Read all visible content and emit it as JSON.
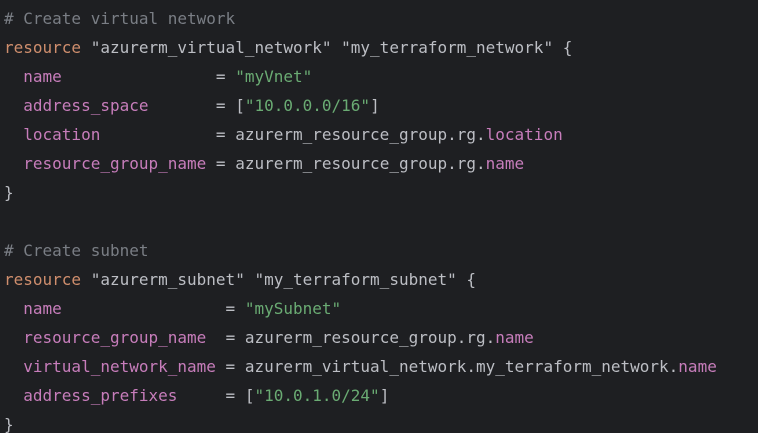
{
  "editor": {
    "theme": {
      "background": "#1e1f22",
      "comment": "#7a7e85",
      "keyword": "#cf8e6d",
      "string": "#6aab73",
      "attribute": "#c77dbb",
      "text": "#bcbec4"
    },
    "lines": [
      [
        {
          "t": "# Create virtual network",
          "c": "comment"
        }
      ],
      [
        {
          "t": "resource",
          "c": "keyword"
        },
        {
          "t": " \"azurerm_virtual_network\" \"my_terraform_network\" {",
          "c": "plain"
        }
      ],
      [
        {
          "t": "  ",
          "c": "plain"
        },
        {
          "t": "name",
          "c": "attr"
        },
        {
          "t": "                = ",
          "c": "plain"
        },
        {
          "t": "\"myVnet\"",
          "c": "string"
        }
      ],
      [
        {
          "t": "  ",
          "c": "plain"
        },
        {
          "t": "address_space",
          "c": "attr"
        },
        {
          "t": "       = [",
          "c": "plain"
        },
        {
          "t": "\"10.0.0.0/16\"",
          "c": "string"
        },
        {
          "t": "]",
          "c": "plain"
        }
      ],
      [
        {
          "t": "  ",
          "c": "plain"
        },
        {
          "t": "location",
          "c": "attr"
        },
        {
          "t": "            = azurerm_resource_group.rg.",
          "c": "plain"
        },
        {
          "t": "location",
          "c": "attr"
        }
      ],
      [
        {
          "t": "  ",
          "c": "plain"
        },
        {
          "t": "resource_group_name",
          "c": "attr"
        },
        {
          "t": " = azurerm_resource_group.rg.",
          "c": "plain"
        },
        {
          "t": "name",
          "c": "attr"
        }
      ],
      [
        {
          "t": "}",
          "c": "plain"
        }
      ],
      [],
      [
        {
          "t": "# Create subnet",
          "c": "comment"
        }
      ],
      [
        {
          "t": "resource",
          "c": "keyword"
        },
        {
          "t": " \"azurerm_subnet\" \"my_terraform_subnet\" {",
          "c": "plain"
        }
      ],
      [
        {
          "t": "  ",
          "c": "plain"
        },
        {
          "t": "name",
          "c": "attr"
        },
        {
          "t": "                 = ",
          "c": "plain"
        },
        {
          "t": "\"mySubnet\"",
          "c": "string"
        }
      ],
      [
        {
          "t": "  ",
          "c": "plain"
        },
        {
          "t": "resource_group_name",
          "c": "attr"
        },
        {
          "t": "  = azurerm_resource_group.rg.",
          "c": "plain"
        },
        {
          "t": "name",
          "c": "attr"
        }
      ],
      [
        {
          "t": "  ",
          "c": "plain"
        },
        {
          "t": "virtual_network_name",
          "c": "attr"
        },
        {
          "t": " = azurerm_virtual_network.my_terraform_network.",
          "c": "plain"
        },
        {
          "t": "name",
          "c": "attr"
        }
      ],
      [
        {
          "t": "  ",
          "c": "plain"
        },
        {
          "t": "address_prefixes",
          "c": "attr"
        },
        {
          "t": "     = [",
          "c": "plain"
        },
        {
          "t": "\"10.0.1.0/24\"",
          "c": "string"
        },
        {
          "t": "]",
          "c": "plain"
        }
      ],
      [
        {
          "t": "}",
          "c": "plain"
        }
      ]
    ]
  }
}
